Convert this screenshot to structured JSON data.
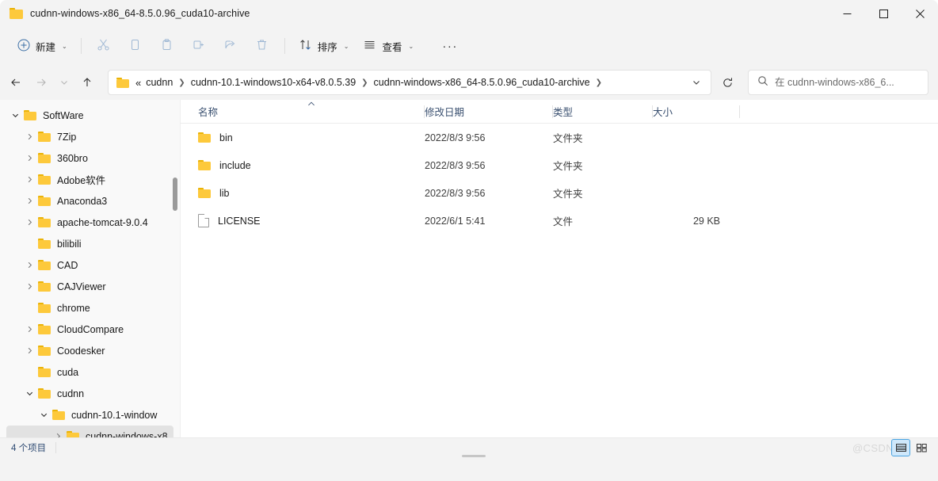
{
  "window": {
    "title": "cudnn-windows-x86_64-8.5.0.96_cuda10-archive",
    "folder_icon": "folder-icon",
    "controls": {
      "minimize": "minimize-icon",
      "maximize": "maximize-icon",
      "close": "close-icon"
    }
  },
  "toolbar": {
    "new_label": "新建",
    "sort_label": "排序",
    "view_label": "查看",
    "more_label": "···",
    "items": [
      {
        "name": "cut",
        "icon": "scissors-icon",
        "disabled": true
      },
      {
        "name": "copy",
        "icon": "copy-icon",
        "disabled": true
      },
      {
        "name": "paste",
        "icon": "paste-icon",
        "disabled": true
      },
      {
        "name": "rename",
        "icon": "rename-icon",
        "disabled": true
      },
      {
        "name": "share",
        "icon": "share-icon",
        "disabled": true
      },
      {
        "name": "delete",
        "icon": "trash-icon",
        "disabled": true
      }
    ]
  },
  "address": {
    "back": "back-arrow-icon",
    "forward": "forward-arrow-icon",
    "recent": "chevron-down-icon",
    "up": "up-arrow-icon",
    "overflow": "«",
    "crumbs": [
      "cudnn",
      "cudnn-10.1-windows10-x64-v8.0.5.39",
      "cudnn-windows-x86_64-8.5.0.96_cuda10-archive"
    ],
    "dropdown": "chevron-down-icon",
    "refresh": "refresh-icon"
  },
  "search": {
    "placeholder": "在 cudnn-windows-x86_6...",
    "value": "",
    "icon": "search-icon"
  },
  "sidebar": {
    "items": [
      {
        "label": "SoftWare",
        "depth": 0,
        "expander": "expanded",
        "selected": false
      },
      {
        "label": "7Zip",
        "depth": 1,
        "expander": "collapsed",
        "selected": false
      },
      {
        "label": "360bro",
        "depth": 1,
        "expander": "collapsed",
        "selected": false
      },
      {
        "label": "Adobe软件",
        "depth": 1,
        "expander": "collapsed",
        "selected": false
      },
      {
        "label": "Anaconda3",
        "depth": 1,
        "expander": "collapsed",
        "selected": false
      },
      {
        "label": "apache-tomcat-9.0.4",
        "depth": 1,
        "expander": "collapsed",
        "selected": false
      },
      {
        "label": "bilibili",
        "depth": 1,
        "expander": "none",
        "selected": false
      },
      {
        "label": "CAD",
        "depth": 1,
        "expander": "collapsed",
        "selected": false
      },
      {
        "label": "CAJViewer",
        "depth": 1,
        "expander": "collapsed",
        "selected": false
      },
      {
        "label": "chrome",
        "depth": 1,
        "expander": "none",
        "selected": false
      },
      {
        "label": "CloudCompare",
        "depth": 1,
        "expander": "collapsed",
        "selected": false
      },
      {
        "label": "Coodesker",
        "depth": 1,
        "expander": "collapsed",
        "selected": false
      },
      {
        "label": "cuda",
        "depth": 1,
        "expander": "none",
        "selected": false
      },
      {
        "label": "cudnn",
        "depth": 1,
        "expander": "expanded",
        "selected": false
      },
      {
        "label": "cudnn-10.1-window",
        "depth": 2,
        "expander": "expanded",
        "selected": false
      },
      {
        "label": "cudnn-windows-x8",
        "depth": 3,
        "expander": "collapsed",
        "selected": true
      }
    ]
  },
  "filelist": {
    "columns": [
      {
        "key": "name",
        "label": "名称",
        "sorted": "asc"
      },
      {
        "key": "date",
        "label": "修改日期",
        "sorted": ""
      },
      {
        "key": "type",
        "label": "类型",
        "sorted": ""
      },
      {
        "key": "size",
        "label": "大小",
        "sorted": ""
      }
    ],
    "rows": [
      {
        "name": "bin",
        "icon": "folder-icon",
        "date": "2022/8/3 9:56",
        "type": "文件夹",
        "size": ""
      },
      {
        "name": "include",
        "icon": "folder-icon",
        "date": "2022/8/3 9:56",
        "type": "文件夹",
        "size": ""
      },
      {
        "name": "lib",
        "icon": "folder-icon",
        "date": "2022/8/3 9:56",
        "type": "文件夹",
        "size": ""
      },
      {
        "name": "LICENSE",
        "icon": "file-icon",
        "date": "2022/6/1 5:41",
        "type": "文件",
        "size": "29 KB"
      }
    ]
  },
  "statusbar": {
    "item_count": "4 个项目",
    "watermark": "@CSDN",
    "view_details": "details-view-icon",
    "view_large_icons": "large-icons-view-icon"
  },
  "colors": {
    "accent": "#4aa3e0",
    "folder": "#fdc93b",
    "header_text": "#3a5070",
    "chrome_bg": "#f3f3f3",
    "sidebar_bg": "#f9f9f9"
  }
}
